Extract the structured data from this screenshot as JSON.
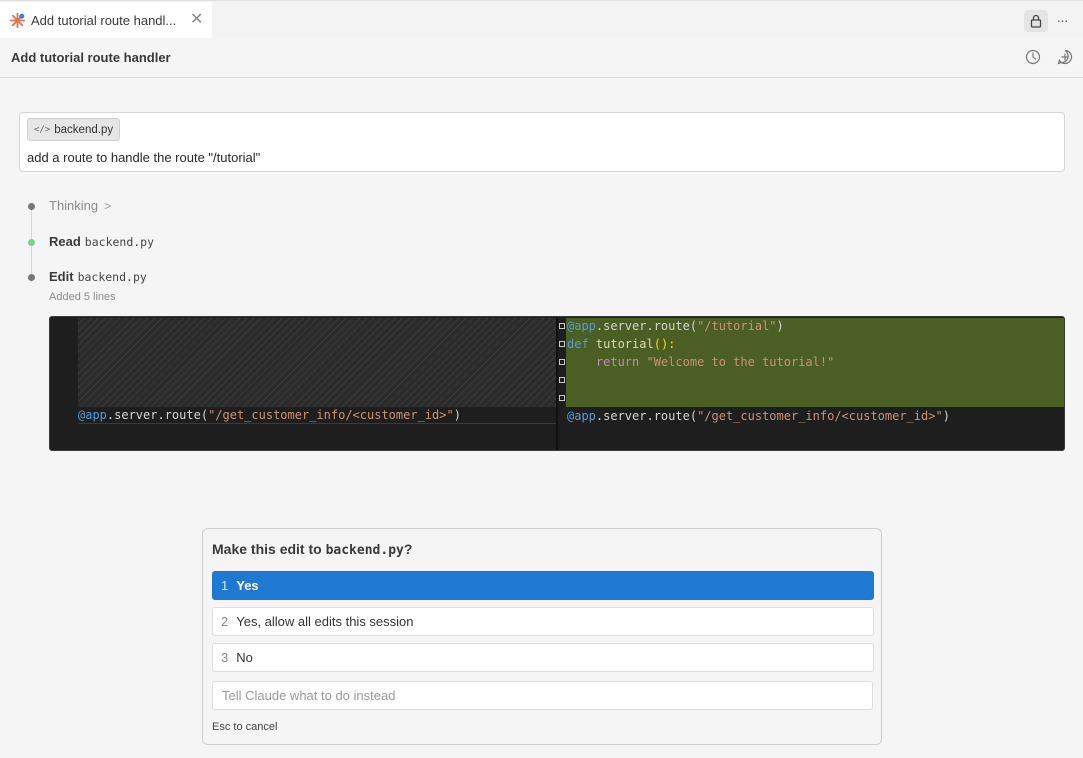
{
  "tab": {
    "title": "Add tutorial route handl...",
    "close": "✕"
  },
  "topbar": {
    "more": "···"
  },
  "header": {
    "title": "Add tutorial route handler"
  },
  "prompt": {
    "file_chip": "backend.py",
    "file_chip_icon": "</>",
    "text": "add a route to handle the route \"/tutorial\""
  },
  "timeline": {
    "thinking": "Thinking",
    "read_label": "Read",
    "read_file": "backend.py",
    "edit_label": "Edit",
    "edit_file": "backend.py",
    "edit_summary": "Added 5 lines"
  },
  "diff": {
    "left_line": {
      "decorator": "@app",
      "call": ".server.route(",
      "arg": "\"/get_customer_info/<customer_id>\"",
      "close": ")"
    },
    "right_added": [
      {
        "decorator": "@app",
        "call": ".server.route(",
        "arg": "\"/tutorial\"",
        "close": ")"
      },
      {
        "kw": "def",
        "name": " tutorial",
        "paren": "():"
      },
      {
        "indent": "    ",
        "kw": "return",
        "str": " \"Welcome to the tutorial!\""
      }
    ],
    "right_line": {
      "decorator": "@app",
      "call": ".server.route(",
      "arg": "\"/get_customer_info/<customer_id>\"",
      "close": ")"
    }
  },
  "dialog": {
    "title_prefix": "Make this edit to ",
    "title_file": "backend.py",
    "title_suffix": "?",
    "options": [
      {
        "num": "1",
        "label": "Yes"
      },
      {
        "num": "2",
        "label": "Yes, allow all edits this session"
      },
      {
        "num": "3",
        "label": "No"
      }
    ],
    "instead_placeholder": "Tell Claude what to do instead",
    "esc_hint": "Esc to cancel"
  },
  "colors": {
    "accent": "#1f78d1",
    "added_bg": "#4b5e23",
    "read_dot": "#7ccf8c"
  }
}
